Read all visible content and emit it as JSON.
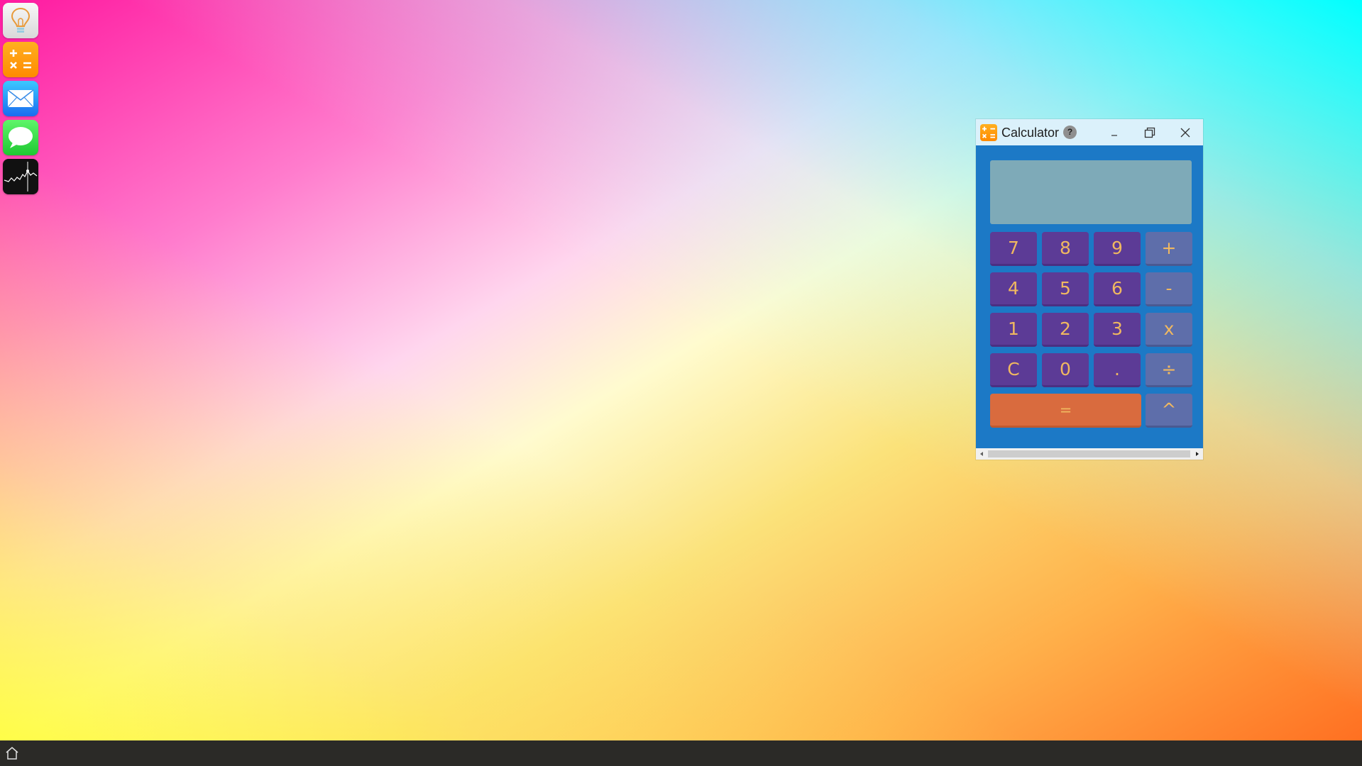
{
  "dock": {
    "apps": [
      {
        "name": "tips",
        "icon": "lightbulb-icon"
      },
      {
        "name": "calculator",
        "icon": "calculator-icon"
      },
      {
        "name": "mail",
        "icon": "envelope-icon"
      },
      {
        "name": "messages",
        "icon": "speech-bubble-icon"
      },
      {
        "name": "stocks",
        "icon": "stock-chart-icon"
      }
    ]
  },
  "taskbar": {
    "home_icon": "home-icon"
  },
  "window": {
    "title": "Calculator",
    "help_label": "?",
    "controls": [
      "minimize",
      "maximize",
      "close"
    ],
    "display_value": "",
    "keys": {
      "k7": "7",
      "k8": "8",
      "k9": "9",
      "plus": "+",
      "k4": "4",
      "k5": "5",
      "k6": "6",
      "minus": "-",
      "k1": "1",
      "k2": "2",
      "k3": "3",
      "times": "x",
      "clear": "C",
      "k0": "0",
      "dot": ".",
      "divide": "÷",
      "equals": "=",
      "power": "^"
    }
  },
  "colors": {
    "window_bg": "#1c79c6",
    "titlebar_bg": "#dbf1fb",
    "number_key": "#5c3b96",
    "operator_key": "#5e6eaa",
    "equals_key": "#d96b3e",
    "key_text": "#f0b860",
    "display_bg": "#7eaab8",
    "taskbar_bg": "#2b2a27"
  }
}
